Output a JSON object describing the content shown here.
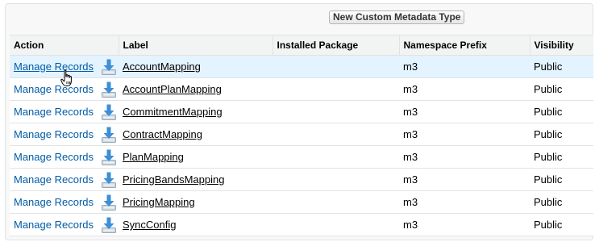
{
  "toolbar": {
    "new_button_label": "New Custom Metadata Type"
  },
  "table": {
    "headers": {
      "action": "Action",
      "label": "Label",
      "installed_package": "Installed Package",
      "namespace_prefix": "Namespace Prefix",
      "visibility": "Visibility"
    },
    "rows": [
      {
        "action": "Manage Records",
        "label": "AccountMapping",
        "installed_package": "",
        "namespace_prefix": "m3",
        "visibility": "Public"
      },
      {
        "action": "Manage Records",
        "label": "AccountPlanMapping",
        "installed_package": "",
        "namespace_prefix": "m3",
        "visibility": "Public"
      },
      {
        "action": "Manage Records",
        "label": "CommitmentMapping",
        "installed_package": "",
        "namespace_prefix": "m3",
        "visibility": "Public"
      },
      {
        "action": "Manage Records",
        "label": "ContractMapping",
        "installed_package": "",
        "namespace_prefix": "m3",
        "visibility": "Public"
      },
      {
        "action": "Manage Records",
        "label": "PlanMapping",
        "installed_package": "",
        "namespace_prefix": "m3",
        "visibility": "Public"
      },
      {
        "action": "Manage Records",
        "label": "PricingBandsMapping",
        "installed_package": "",
        "namespace_prefix": "m3",
        "visibility": "Public"
      },
      {
        "action": "Manage Records",
        "label": "PricingMapping",
        "installed_package": "",
        "namespace_prefix": "m3",
        "visibility": "Public"
      },
      {
        "action": "Manage Records",
        "label": "SyncConfig",
        "installed_package": "",
        "namespace_prefix": "m3",
        "visibility": "Public"
      }
    ]
  },
  "icons": {
    "row_action_icon": "download-icon",
    "pointer": "hand-pointer-icon"
  },
  "colors": {
    "link": "#015ba7",
    "row_hover": "#e3f3ff",
    "header_bg": "#f2f3f3",
    "icon_blue": "#3d8fd6"
  }
}
